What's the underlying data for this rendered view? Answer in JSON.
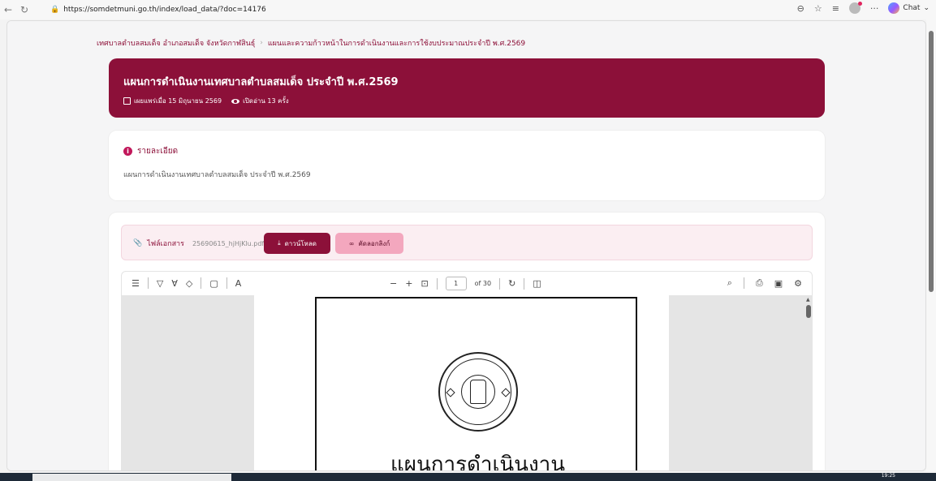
{
  "browser": {
    "url": "https://somdetmuni.go.th/index/load_data/?doc=14176",
    "chat_label": "Chat"
  },
  "breadcrumb": {
    "home": "เทศบาลตำบลสมเด็จ อำเภอสมเด็จ จังหวัดกาฬสินธุ์",
    "separator": "›",
    "current": "แผนและความก้าวหน้าในการดำเนินงานและการใช้งบประมาณประจำปี พ.ศ.2569"
  },
  "hero": {
    "title": "แผนการดำเนินงานเทศบาลตำบลสมเด็จ ประจำปี พ.ศ.2569",
    "published": "เผยแพร่เมื่อ 15 มิถุนายน 2569",
    "views": "เปิดอ่าน 13 ครั้ง"
  },
  "details": {
    "heading": "รายละเอียด",
    "description": "แผนการดำเนินงานเทศบาลตำบลสมเด็จ ประจำปี พ.ศ.2569"
  },
  "file": {
    "label": "ไฟล์เอกสาร",
    "filename": "25690615_hjHjKlu.pdf",
    "download_label": "ดาวน์โหลด",
    "copy_label": "คัดลอกลิงก์"
  },
  "pdf_toolbar": {
    "minus": "−",
    "plus": "+",
    "page": "1",
    "of_pages": "of 30",
    "text_tool": "A"
  },
  "pdf_page": {
    "title": "แผนการดำเนินงาน"
  },
  "taskbar": {
    "time": "19:25"
  },
  "colors": {
    "accent": "#8c1039",
    "accent_light": "#f3a7be"
  }
}
